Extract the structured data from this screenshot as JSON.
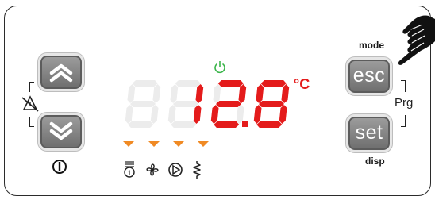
{
  "controller": {
    "display_value": "12.8",
    "unit": "°C",
    "labels": {
      "mode": "mode",
      "prg": "Prg",
      "disp": "disp"
    },
    "buttons": {
      "esc": "esc",
      "set": "set"
    },
    "colors": {
      "display": "#e41b1b",
      "segment_off": "#ececec",
      "indicator": "#f08a24",
      "power_icon": "#3ab54a",
      "button": "#7f7f7f"
    },
    "icons": [
      "power-icon",
      "alarm-mute-icon",
      "on-off-icon",
      "compressor-step-icon",
      "fan-icon",
      "pump-icon",
      "heater-icon",
      "hand-pointer-icon"
    ],
    "indicators": 4
  }
}
